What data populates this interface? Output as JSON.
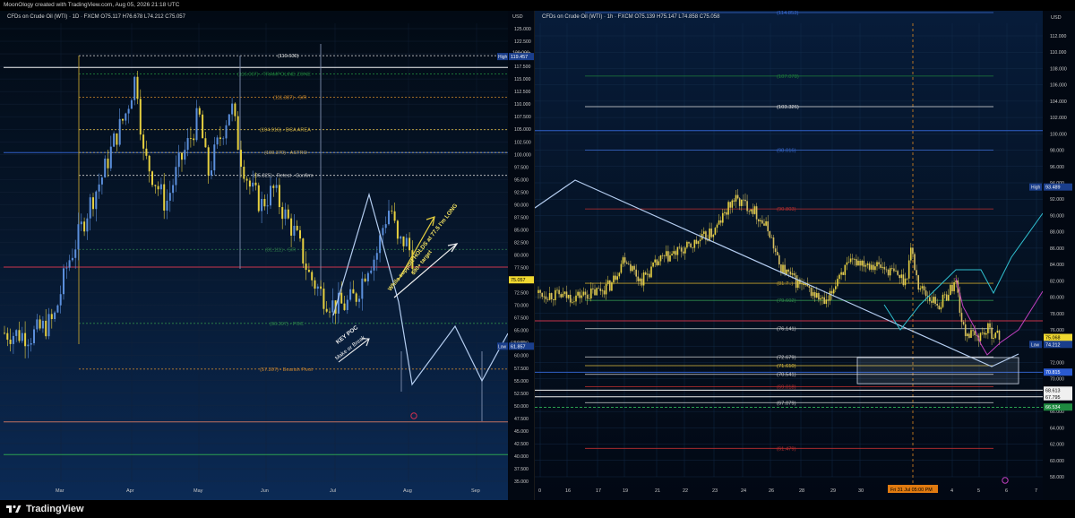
{
  "header": {
    "created_text": "MoonOlogy created with TradingView.com, Aug 05, 2026 21:18 UTC"
  },
  "footer": {
    "brand": "TradingView"
  },
  "left_chart": {
    "legend": "CFDs on Crude Oil (WTI) · 1D · FXCM  O75.117  H76.678  L74.212  C75.057",
    "currency": "USD",
    "y_ticks": [
      "125.000",
      "122.500",
      "120.000",
      "117.500",
      "115.000",
      "112.500",
      "110.000",
      "107.500",
      "105.000",
      "102.500",
      "100.000",
      "97.500",
      "95.000",
      "92.500",
      "90.000",
      "87.500",
      "85.000",
      "82.500",
      "80.000",
      "77.500",
      "75.000",
      "72.500",
      "70.000",
      "67.500",
      "65.000",
      "62.500",
      "60.000",
      "57.500",
      "55.000",
      "52.500",
      "50.000",
      "47.500",
      "45.000",
      "42.500",
      "40.000",
      "37.500",
      "35.000"
    ],
    "x_ticks": [
      "Mar",
      "Apr",
      "May",
      "Jun",
      "Jul",
      "Aug",
      "Sep"
    ],
    "levels": [
      {
        "label": "(119.630)",
        "color": "#e0e0e0"
      },
      {
        "label": "(116.007) - TRAMPOLINE ZONE",
        "color": "#1e7f3a"
      },
      {
        "label": "(111.387) - S/R",
        "color": "#d08a2a"
      },
      {
        "label": "(104.916) - DCA AREA",
        "color": "#d0b040"
      },
      {
        "label": "(100.370) - ASTRO",
        "color": "#b8a060"
      },
      {
        "label": "(95.825) - Retest - Confirm",
        "color": "#d0d0d0"
      },
      {
        "label": "(81.111) - S/R",
        "color": "#2e7a4a"
      },
      {
        "label": "(66.397) - POC",
        "color": "#2e8a4a"
      },
      {
        "label": "(57.307) - Bearish Pivot",
        "color": "#c08030"
      }
    ],
    "price_tags": {
      "high_label": "High",
      "high": "119.457",
      "last": "75.057",
      "low_label": "Low",
      "low": "61.857",
      "partial_top": "120.000",
      "partial_low": "62.500"
    },
    "annotations": {
      "key_poc": "KEY POC",
      "make_or_break": "Make or Break",
      "support_note": "While support HOLDS at 77.5 I'm LONG",
      "target_note": "$90+ target"
    }
  },
  "right_chart": {
    "legend": "CFDs on Crude Oil (WTI) · 1h · FXCM  O75.139  H75.147  L74.858  C75.058",
    "currency": "USD",
    "y_ticks": [
      "112.000",
      "110.000",
      "108.000",
      "106.000",
      "104.000",
      "102.000",
      "100.000",
      "98.000",
      "96.000",
      "94.000",
      "92.000",
      "90.000",
      "88.000",
      "86.000",
      "84.000",
      "82.000",
      "80.000",
      "78.000",
      "76.000",
      "74.000",
      "72.000",
      "70.000",
      "68.000",
      "66.000",
      "64.000",
      "62.000",
      "60.000",
      "58.000"
    ],
    "x_ticks": [
      "0",
      "16",
      "17",
      "19",
      "21",
      "22",
      "23",
      "24",
      "26",
      "28",
      "29",
      "30",
      "4",
      "5",
      "6",
      "7"
    ],
    "x_highlight": "Fri 31 Jul   05:00 PM",
    "levels": [
      {
        "label": "(114.853)",
        "color": "#3a6ad0"
      },
      {
        "label": "(107.078)",
        "color": "#1e7f3a"
      },
      {
        "label": "(103.326)",
        "color": "#e0e0e0"
      },
      {
        "label": "(98.016)",
        "color": "#3a6ad0"
      },
      {
        "label": "(90.803)",
        "color": "#c03030"
      },
      {
        "label": "(81.7..)",
        "color": "#c0a030"
      },
      {
        "label": "(79.602)",
        "color": "#2e8a4a"
      },
      {
        "label": "(76.141)",
        "color": "#d0d0d0"
      },
      {
        "label": "(72.679)",
        "color": "#d0d0d0"
      },
      {
        "label": "(71.610)",
        "color": "#e0c040"
      },
      {
        "label": "(70.541)",
        "color": "#d0d0d0"
      },
      {
        "label": "(69.018)",
        "color": "#c03030"
      },
      {
        "label": "(67.079)",
        "color": "#d0d0d0"
      },
      {
        "label": "(61.479)",
        "color": "#c03030"
      }
    ],
    "price_tags": {
      "high_label": "High",
      "high": "93.489",
      "last": "75.068",
      "low_label": "Low",
      "low": "74.212",
      "tag_blue": "70.815",
      "tag_white1": "68.613",
      "tag_white2": "67.795",
      "tag_green": "66.534"
    }
  }
}
